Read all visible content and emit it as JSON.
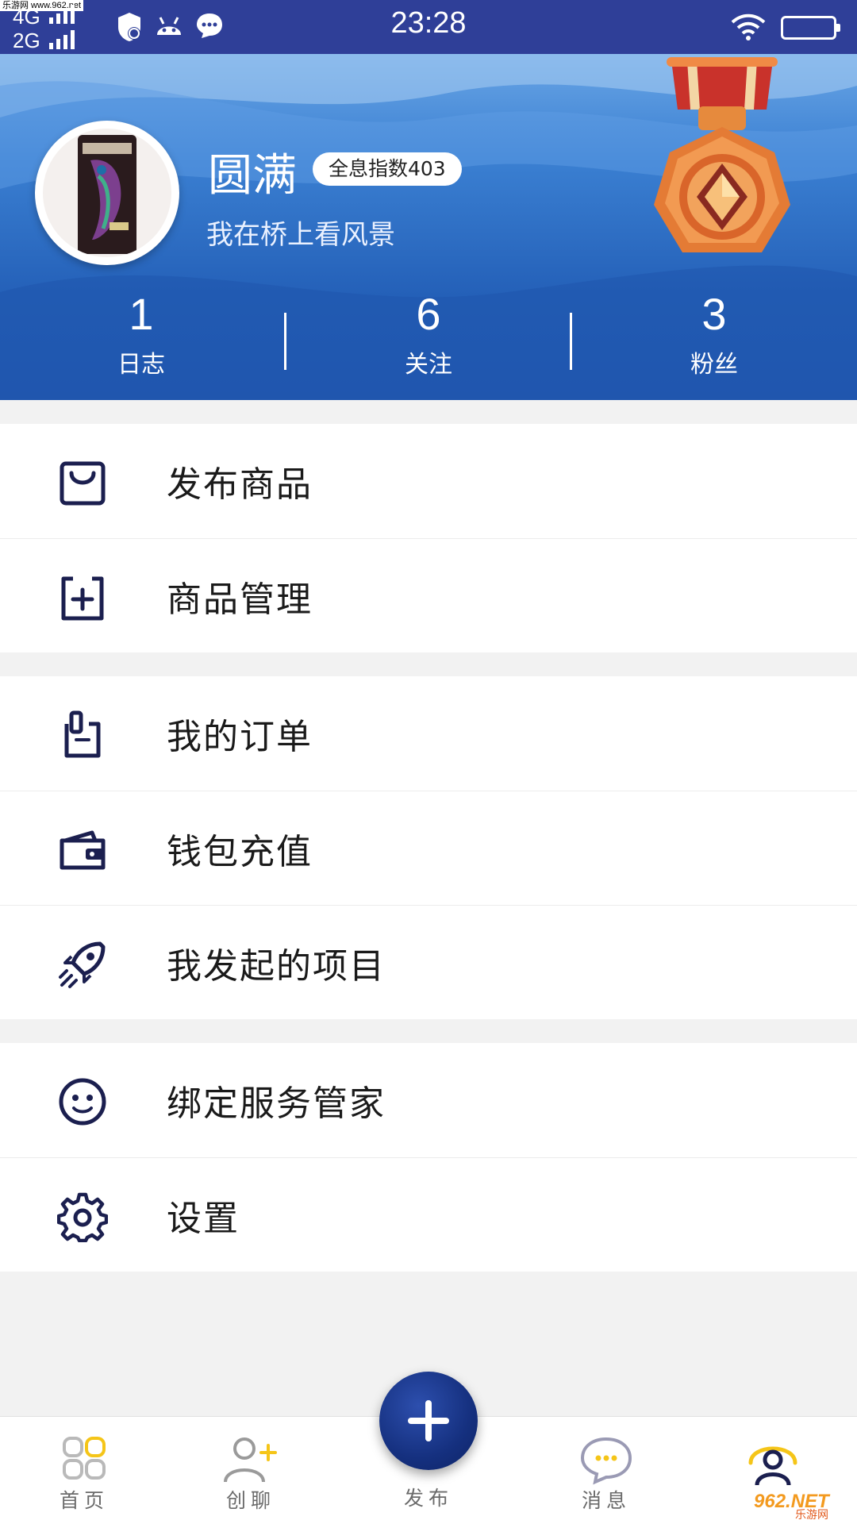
{
  "status_bar": {
    "watermark": "乐游网 www.962.net",
    "network_1": "4G",
    "network_2": "2G",
    "time": "23:28"
  },
  "profile": {
    "name": "圆满",
    "score_badge": "全息指数403",
    "bio": "我在桥上看风景",
    "stats": [
      {
        "value": "1",
        "label": "日志"
      },
      {
        "value": "6",
        "label": "关注"
      },
      {
        "value": "3",
        "label": "粉丝"
      }
    ]
  },
  "menu": {
    "group1": [
      {
        "label": "发布商品",
        "icon": "shopping-bag-icon"
      },
      {
        "label": "商品管理",
        "icon": "add-square-icon"
      }
    ],
    "group2": [
      {
        "label": "我的订单",
        "icon": "clipboard-icon"
      },
      {
        "label": "钱包充值",
        "icon": "wallet-icon"
      },
      {
        "label": "我发起的项目",
        "icon": "rocket-icon"
      }
    ],
    "group3": [
      {
        "label": "绑定服务管家",
        "icon": "smiley-icon"
      },
      {
        "label": "设置",
        "icon": "gear-icon"
      }
    ]
  },
  "tab_bar": {
    "home": "首页",
    "chat": "创聊",
    "publish": "发布",
    "messages": "消息"
  },
  "watermark_bottom": {
    "logo": "962.NET",
    "sub": "乐游网"
  },
  "colors": {
    "status_bar": "#2f3f98",
    "header_blue": "#2460b8",
    "icon_navy": "#1b1f4f",
    "publish_button": "#15307f",
    "accent_yellow": "#f5c518"
  }
}
